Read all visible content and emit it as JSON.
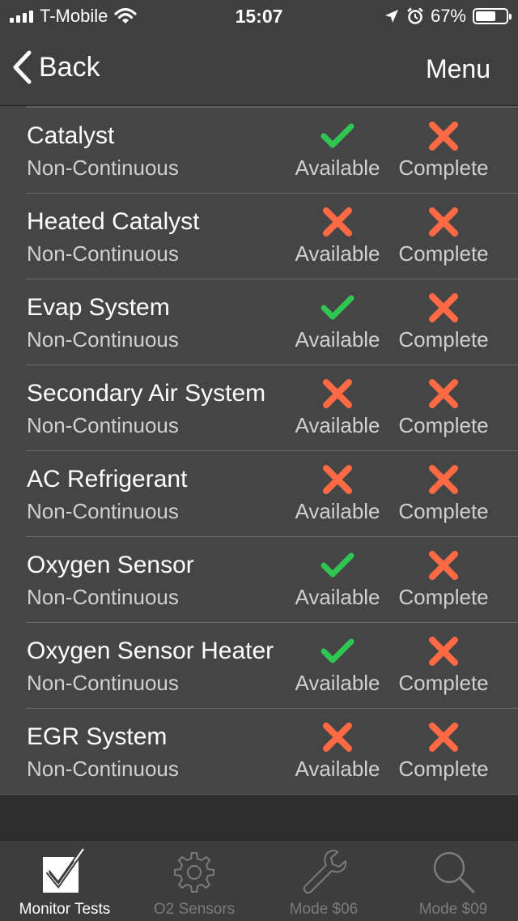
{
  "status_bar": {
    "carrier": "T-Mobile",
    "time": "15:07",
    "battery": "67%",
    "battery_level": 0.67
  },
  "nav": {
    "back_label": "Back",
    "menu_label": "Menu"
  },
  "monitors": [
    {
      "name": "Catalyst",
      "type": "Non-Continuous",
      "available": true,
      "complete": false
    },
    {
      "name": "Heated Catalyst",
      "type": "Non-Continuous",
      "available": false,
      "complete": false
    },
    {
      "name": "Evap System",
      "type": "Non-Continuous",
      "available": true,
      "complete": false
    },
    {
      "name": "Secondary Air System",
      "type": "Non-Continuous",
      "available": false,
      "complete": false
    },
    {
      "name": "AC Refrigerant",
      "type": "Non-Continuous",
      "available": false,
      "complete": false
    },
    {
      "name": "Oxygen Sensor",
      "type": "Non-Continuous",
      "available": true,
      "complete": false
    },
    {
      "name": "Oxygen Sensor Heater",
      "type": "Non-Continuous",
      "available": true,
      "complete": false
    },
    {
      "name": "EGR System",
      "type": "Non-Continuous",
      "available": false,
      "complete": false
    }
  ],
  "status_labels": {
    "available": "Available",
    "complete": "Complete"
  },
  "colors": {
    "check": "#2fc652",
    "cross": "#ff6a45"
  },
  "tabs": [
    {
      "label": "Monitor Tests",
      "icon": "checkbox-icon",
      "active": true
    },
    {
      "label": "O2 Sensors",
      "icon": "gear-icon",
      "active": false
    },
    {
      "label": "Mode $06",
      "icon": "wrench-icon",
      "active": false
    },
    {
      "label": "Mode $09",
      "icon": "magnifier-icon",
      "active": false
    }
  ]
}
